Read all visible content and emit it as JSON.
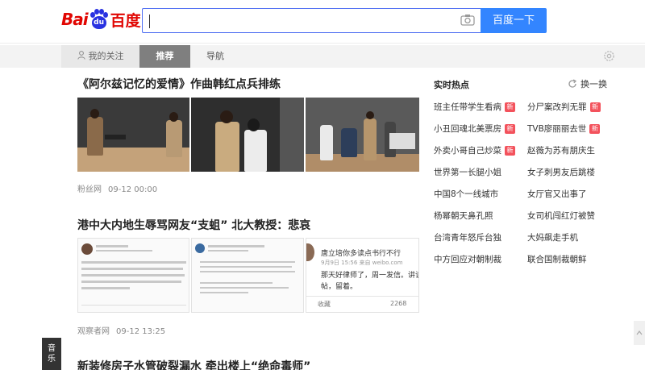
{
  "header": {
    "logo": {
      "latin": "Bai",
      "paw_text": "du",
      "chinese": "百度"
    },
    "search": {
      "value": "",
      "placeholder": ""
    },
    "search_button": "百度一下"
  },
  "tabs": [
    {
      "label": "我的关注"
    },
    {
      "label": "推荐"
    },
    {
      "label": "导航"
    }
  ],
  "feed": [
    {
      "title": "《阿尔兹记忆的爱情》作曲韩红点兵排练",
      "source": "粉丝网",
      "time": "09-12 00:00"
    },
    {
      "title": "港中大内地生辱骂网友“支蛆” 北大教授：悲哀",
      "source": "观察者网",
      "time": "09-12 13:25",
      "weibo_card": {
        "title": "唐立培你多读点书行不行",
        "line1": "9月9日 15:56 来自 weibo.com",
        "line2": "那天好律师了，周一发信。讲谈",
        "line3": "帖，留着。",
        "fav": "收藏",
        "count": "2268"
      }
    },
    {
      "title": "新装修房子水管破裂漏水 牵出楼上“绝命毒师”"
    }
  ],
  "hot": {
    "title": "实时热点",
    "refresh": "换一换",
    "items": [
      {
        "text": "班主任带学生看病",
        "new": "新"
      },
      {
        "text": "分尸案改判无罪",
        "new": "新"
      },
      {
        "text": "小丑回魂北美票房",
        "new": "新"
      },
      {
        "text": "TVB廖丽丽去世",
        "new": "新"
      },
      {
        "text": "外卖小哥自己炒菜",
        "new": "新"
      },
      {
        "text": "赵薇为苏有朋庆生",
        "new": ""
      },
      {
        "text": "世界第一长腿小姐",
        "new": ""
      },
      {
        "text": "女子刺男友后跳楼",
        "new": ""
      },
      {
        "text": "中国8个一线城市",
        "new": ""
      },
      {
        "text": "女厅官又出事了",
        "new": ""
      },
      {
        "text": "杨幂朝天鼻孔照",
        "new": ""
      },
      {
        "text": "女司机闯红灯被赞",
        "new": ""
      },
      {
        "text": "台湾青年怒斥台独",
        "new": ""
      },
      {
        "text": "大妈飙走手机",
        "new": ""
      },
      {
        "text": "中方回应对朝制裁",
        "new": ""
      },
      {
        "text": "联合国制裁朝鲜",
        "new": ""
      }
    ]
  },
  "side": {
    "music": "音乐"
  },
  "colors": {
    "brand_red": "#e10602",
    "brand_blue": "#2932e1",
    "button_blue": "#3385ff",
    "new_badge": "#f3525c"
  }
}
